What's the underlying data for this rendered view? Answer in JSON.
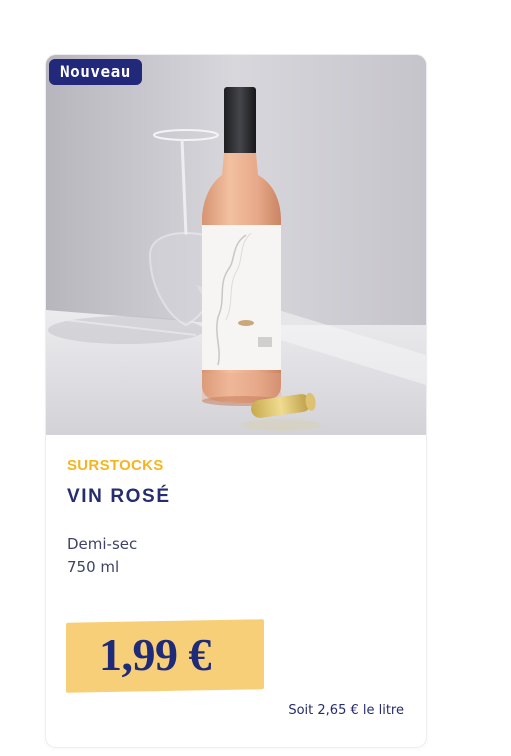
{
  "product": {
    "badge": "Nouveau",
    "category": "SURSTOCKS",
    "title": "VIN ROSÉ",
    "description_line1": "Demi-sec",
    "description_line2": "750 ml",
    "price": "1,99 €",
    "unit_price": "Soit 2,65 € le litre",
    "image": "rose-wine-bottle-with-glass-photo"
  },
  "colors": {
    "badge_bg": "#22297a",
    "category": "#f5b521",
    "title": "#262c6e",
    "price_box": "#f8cf79",
    "price_text": "#1f2a78"
  }
}
